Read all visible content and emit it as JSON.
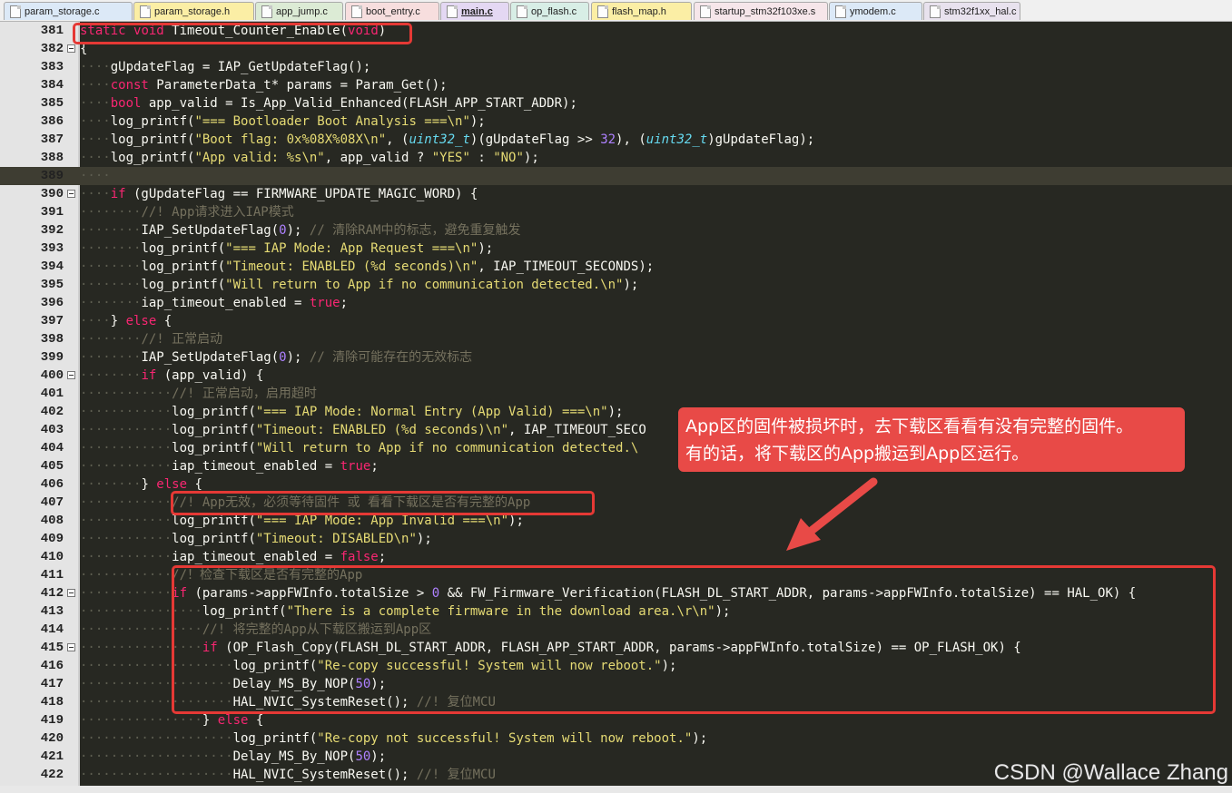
{
  "tabs": [
    {
      "label": "param_storage.c",
      "color": "#dce9f7",
      "active": false
    },
    {
      "label": "param_storage.h",
      "color": "#fbeea5",
      "active": false
    },
    {
      "label": "app_jump.c",
      "color": "#dcebd5",
      "active": false
    },
    {
      "label": "boot_entry.c",
      "color": "#f7dede",
      "active": false
    },
    {
      "label": "main.c",
      "color": "#e4d8f3",
      "active": true
    },
    {
      "label": "op_flash.c",
      "color": "#d8eee6",
      "active": false
    },
    {
      "label": "flash_map.h",
      "color": "#fbeea5",
      "active": false
    },
    {
      "label": "startup_stm32f103xe.s",
      "color": "#f6e6ea",
      "active": false
    },
    {
      "label": "ymodem.c",
      "color": "#dce9f7",
      "active": false
    },
    {
      "label": "stm32f1xx_hal.c",
      "color": "#e8e2ee",
      "active": false
    }
  ],
  "code_lines": [
    {
      "n": "381",
      "fold": false,
      "hl": false,
      "indent": 0,
      "code": [
        [
          "k",
          "static"
        ],
        [
          "p",
          " "
        ],
        [
          "k",
          "void"
        ],
        [
          "p",
          " Timeout_Counter_Enable("
        ],
        [
          "k",
          "void"
        ],
        [
          "p",
          ")"
        ]
      ]
    },
    {
      "n": "382",
      "fold": true,
      "hl": false,
      "indent": 0,
      "code": [
        [
          "p",
          "{"
        ]
      ]
    },
    {
      "n": "383",
      "fold": false,
      "hl": false,
      "indent": 1,
      "code": [
        [
          "p",
          "gUpdateFlag = IAP_GetUpdateFlag();"
        ]
      ]
    },
    {
      "n": "384",
      "fold": false,
      "hl": false,
      "indent": 1,
      "code": [
        [
          "k",
          "const"
        ],
        [
          "p",
          " ParameterData_t* params = Param_Get();"
        ]
      ]
    },
    {
      "n": "385",
      "fold": false,
      "hl": false,
      "indent": 1,
      "code": [
        [
          "k",
          "bool"
        ],
        [
          "p",
          " app_valid = Is_App_Valid_Enhanced(FLASH_APP_START_ADDR);"
        ]
      ]
    },
    {
      "n": "386",
      "fold": false,
      "hl": false,
      "indent": 1,
      "code": [
        [
          "p",
          "log_printf("
        ],
        [
          "s",
          "\"=== Bootloader Boot Analysis ===\\n\""
        ],
        [
          "p",
          ");"
        ]
      ]
    },
    {
      "n": "387",
      "fold": false,
      "hl": false,
      "indent": 1,
      "code": [
        [
          "p",
          "log_printf("
        ],
        [
          "s",
          "\"Boot flag: 0x%08X%08X\\n\""
        ],
        [
          "p",
          ", ("
        ],
        [
          "t",
          "uint32_t"
        ],
        [
          "p",
          ")(gUpdateFlag >> "
        ],
        [
          "n",
          "32"
        ],
        [
          "p",
          "), ("
        ],
        [
          "t",
          "uint32_t"
        ],
        [
          "p",
          ")gUpdateFlag);"
        ]
      ]
    },
    {
      "n": "388",
      "fold": false,
      "hl": false,
      "indent": 1,
      "code": [
        [
          "p",
          "log_printf("
        ],
        [
          "s",
          "\"App valid: %s\\n\""
        ],
        [
          "p",
          ", app_valid ? "
        ],
        [
          "s",
          "\"YES\""
        ],
        [
          "p",
          " : "
        ],
        [
          "s",
          "\"NO\""
        ],
        [
          "p",
          ");"
        ]
      ]
    },
    {
      "n": "389",
      "fold": false,
      "hl": true,
      "indent": 1,
      "code": []
    },
    {
      "n": "390",
      "fold": true,
      "hl": false,
      "indent": 1,
      "code": [
        [
          "k",
          "if"
        ],
        [
          "p",
          " (gUpdateFlag == FIRMWARE_UPDATE_MAGIC_WORD) {"
        ]
      ]
    },
    {
      "n": "391",
      "fold": false,
      "hl": false,
      "indent": 2,
      "code": [
        [
          "c",
          "//! App请求进入IAP模式"
        ]
      ]
    },
    {
      "n": "392",
      "fold": false,
      "hl": false,
      "indent": 2,
      "code": [
        [
          "p",
          "IAP_SetUpdateFlag("
        ],
        [
          "n",
          "0"
        ],
        [
          "p",
          "); "
        ],
        [
          "c",
          "// 清除RAM中的标志，避免重复触发"
        ]
      ]
    },
    {
      "n": "393",
      "fold": false,
      "hl": false,
      "indent": 2,
      "code": [
        [
          "p",
          "log_printf("
        ],
        [
          "s",
          "\"=== IAP Mode: App Request ===\\n\""
        ],
        [
          "p",
          ");"
        ]
      ]
    },
    {
      "n": "394",
      "fold": false,
      "hl": false,
      "indent": 2,
      "code": [
        [
          "p",
          "log_printf("
        ],
        [
          "s",
          "\"Timeout: ENABLED (%d seconds)\\n\""
        ],
        [
          "p",
          ", IAP_TIMEOUT_SECONDS);"
        ]
      ]
    },
    {
      "n": "395",
      "fold": false,
      "hl": false,
      "indent": 2,
      "code": [
        [
          "p",
          "log_printf("
        ],
        [
          "s",
          "\"Will return to App if no communication detected.\\n\""
        ],
        [
          "p",
          ");"
        ]
      ]
    },
    {
      "n": "396",
      "fold": false,
      "hl": false,
      "indent": 2,
      "code": [
        [
          "p",
          "iap_timeout_enabled = "
        ],
        [
          "k",
          "true"
        ],
        [
          "p",
          ";"
        ]
      ]
    },
    {
      "n": "397",
      "fold": false,
      "hl": false,
      "indent": 1,
      "code": [
        [
          "p",
          "} "
        ],
        [
          "k",
          "else"
        ],
        [
          "p",
          " {"
        ]
      ]
    },
    {
      "n": "398",
      "fold": false,
      "hl": false,
      "indent": 2,
      "code": [
        [
          "c",
          "//! 正常启动"
        ]
      ]
    },
    {
      "n": "399",
      "fold": false,
      "hl": false,
      "indent": 2,
      "code": [
        [
          "p",
          "IAP_SetUpdateFlag("
        ],
        [
          "n",
          "0"
        ],
        [
          "p",
          "); "
        ],
        [
          "c",
          "// 清除可能存在的无效标志"
        ]
      ]
    },
    {
      "n": "400",
      "fold": true,
      "hl": false,
      "indent": 2,
      "code": [
        [
          "k",
          "if"
        ],
        [
          "p",
          " (app_valid) {"
        ]
      ]
    },
    {
      "n": "401",
      "fold": false,
      "hl": false,
      "indent": 3,
      "code": [
        [
          "c",
          "//! 正常启动，启用超时"
        ]
      ]
    },
    {
      "n": "402",
      "fold": false,
      "hl": false,
      "indent": 3,
      "code": [
        [
          "p",
          "log_printf("
        ],
        [
          "s",
          "\"=== IAP Mode: Normal Entry (App Valid) ===\\n\""
        ],
        [
          "p",
          ");"
        ]
      ]
    },
    {
      "n": "403",
      "fold": false,
      "hl": false,
      "indent": 3,
      "code": [
        [
          "p",
          "log_printf("
        ],
        [
          "s",
          "\"Timeout: ENABLED (%d seconds)\\n\""
        ],
        [
          "p",
          ", IAP_TIMEOUT_SECO"
        ]
      ]
    },
    {
      "n": "404",
      "fold": false,
      "hl": false,
      "indent": 3,
      "code": [
        [
          "p",
          "log_printf("
        ],
        [
          "s",
          "\"Will return to App if no communication detected.\\"
        ]
      ]
    },
    {
      "n": "405",
      "fold": false,
      "hl": false,
      "indent": 3,
      "code": [
        [
          "p",
          "iap_timeout_enabled = "
        ],
        [
          "k",
          "true"
        ],
        [
          "p",
          ";"
        ]
      ]
    },
    {
      "n": "406",
      "fold": false,
      "hl": false,
      "indent": 2,
      "code": [
        [
          "p",
          "} "
        ],
        [
          "k",
          "else"
        ],
        [
          "p",
          " {"
        ]
      ]
    },
    {
      "n": "407",
      "fold": false,
      "hl": false,
      "indent": 3,
      "code": [
        [
          "c",
          "//! App无效，必须等待固件 或 看看下载区是否有完整的App"
        ]
      ]
    },
    {
      "n": "408",
      "fold": false,
      "hl": false,
      "indent": 3,
      "code": [
        [
          "p",
          "log_printf("
        ],
        [
          "s",
          "\"=== IAP Mode: App Invalid ===\\n\""
        ],
        [
          "p",
          ");"
        ]
      ]
    },
    {
      "n": "409",
      "fold": false,
      "hl": false,
      "indent": 3,
      "code": [
        [
          "p",
          "log_printf("
        ],
        [
          "s",
          "\"Timeout: DISABLED\\n\""
        ],
        [
          "p",
          ");"
        ]
      ]
    },
    {
      "n": "410",
      "fold": false,
      "hl": false,
      "indent": 3,
      "code": [
        [
          "p",
          "iap_timeout_enabled = "
        ],
        [
          "k",
          "false"
        ],
        [
          "p",
          ";"
        ]
      ]
    },
    {
      "n": "411",
      "fold": false,
      "hl": false,
      "indent": 3,
      "code": [
        [
          "c",
          "//！检查下载区是否有完整的App"
        ]
      ]
    },
    {
      "n": "412",
      "fold": true,
      "hl": false,
      "indent": 3,
      "code": [
        [
          "k",
          "if"
        ],
        [
          "p",
          " (params->appFWInfo.totalSize > "
        ],
        [
          "n",
          "0"
        ],
        [
          "p",
          " && FW_Firmware_Verification(FLASH_DL_START_ADDR, params->appFWInfo.totalSize) == HAL_OK) {"
        ]
      ]
    },
    {
      "n": "413",
      "fold": false,
      "hl": false,
      "indent": 4,
      "code": [
        [
          "p",
          "log_printf("
        ],
        [
          "s",
          "\"There is a complete firmware in the download area.\\r\\n\""
        ],
        [
          "p",
          ");"
        ]
      ]
    },
    {
      "n": "414",
      "fold": false,
      "hl": false,
      "indent": 4,
      "code": [
        [
          "c",
          "//! 将完整的App从下载区搬运到App区"
        ]
      ]
    },
    {
      "n": "415",
      "fold": true,
      "hl": false,
      "indent": 4,
      "code": [
        [
          "k",
          "if"
        ],
        [
          "p",
          " (OP_Flash_Copy(FLASH_DL_START_ADDR, FLASH_APP_START_ADDR, params->appFWInfo.totalSize) == OP_FLASH_OK) {"
        ]
      ]
    },
    {
      "n": "416",
      "fold": false,
      "hl": false,
      "indent": 5,
      "code": [
        [
          "p",
          "log_printf("
        ],
        [
          "s",
          "\"Re-copy successful! System will now reboot.\""
        ],
        [
          "p",
          ");"
        ]
      ]
    },
    {
      "n": "417",
      "fold": false,
      "hl": false,
      "indent": 5,
      "code": [
        [
          "p",
          "Delay_MS_By_NOP("
        ],
        [
          "n",
          "50"
        ],
        [
          "p",
          ");"
        ]
      ]
    },
    {
      "n": "418",
      "fold": false,
      "hl": false,
      "indent": 5,
      "code": [
        [
          "p",
          "HAL_NVIC_SystemReset(); "
        ],
        [
          "c",
          "//! 复位MCU"
        ]
      ]
    },
    {
      "n": "419",
      "fold": false,
      "hl": false,
      "indent": 4,
      "code": [
        [
          "p",
          "} "
        ],
        [
          "k",
          "else"
        ],
        [
          "p",
          " {"
        ]
      ]
    },
    {
      "n": "420",
      "fold": false,
      "hl": false,
      "indent": 5,
      "code": [
        [
          "p",
          "log_printf("
        ],
        [
          "s",
          "\"Re-copy not successful! System will now reboot.\""
        ],
        [
          "p",
          ");"
        ]
      ]
    },
    {
      "n": "421",
      "fold": false,
      "hl": false,
      "indent": 5,
      "code": [
        [
          "p",
          "Delay_MS_By_NOP("
        ],
        [
          "n",
          "50"
        ],
        [
          "p",
          ");"
        ]
      ]
    },
    {
      "n": "422",
      "fold": false,
      "hl": false,
      "indent": 5,
      "code": [
        [
          "p",
          "HAL_NVIC_SystemReset(); "
        ],
        [
          "c",
          "//! 复位MCU"
        ]
      ]
    }
  ],
  "callout": {
    "line1": "App区的固件被损坏时，去下载区看看有没有完整的固件。",
    "line2": "有的话，将下载区的App搬运到App区运行。"
  },
  "watermark": "CSDN @Wallace Zhang",
  "colors": {
    "editor_bg": "#272822",
    "keyword": "#f92672",
    "string": "#e6db74",
    "number": "#ae81ff",
    "type": "#66d9ef",
    "comment": "#75715e",
    "annotation_red": "#e53935"
  }
}
